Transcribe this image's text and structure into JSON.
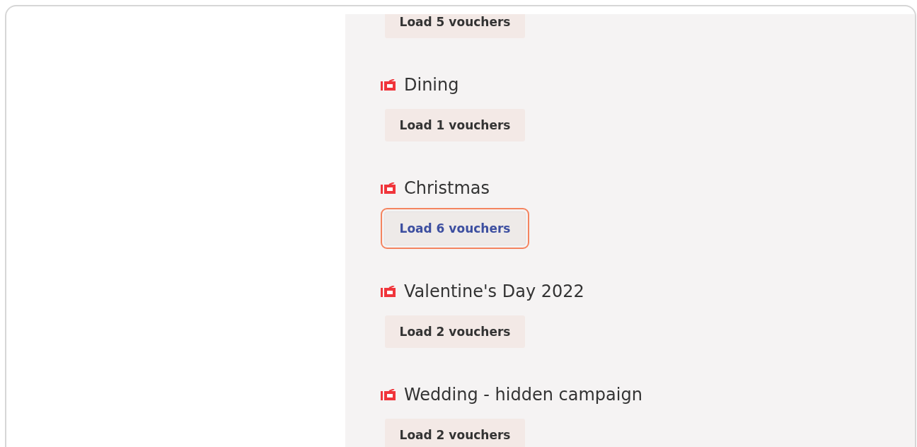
{
  "campaigns": [
    {
      "button": {
        "label": "Load 5 vouchers",
        "highlighted": false
      }
    },
    {
      "title": "Dining",
      "button": {
        "label": "Load 1 vouchers",
        "highlighted": false
      }
    },
    {
      "title": "Christmas",
      "button": {
        "label": "Load 6 vouchers",
        "highlighted": true
      }
    },
    {
      "title": "Valentine's Day 2022",
      "button": {
        "label": "Load 2 vouchers",
        "highlighted": false
      }
    },
    {
      "title": "Wedding - hidden campaign",
      "button": {
        "label": "Load 2 vouchers",
        "highlighted": false
      }
    }
  ]
}
